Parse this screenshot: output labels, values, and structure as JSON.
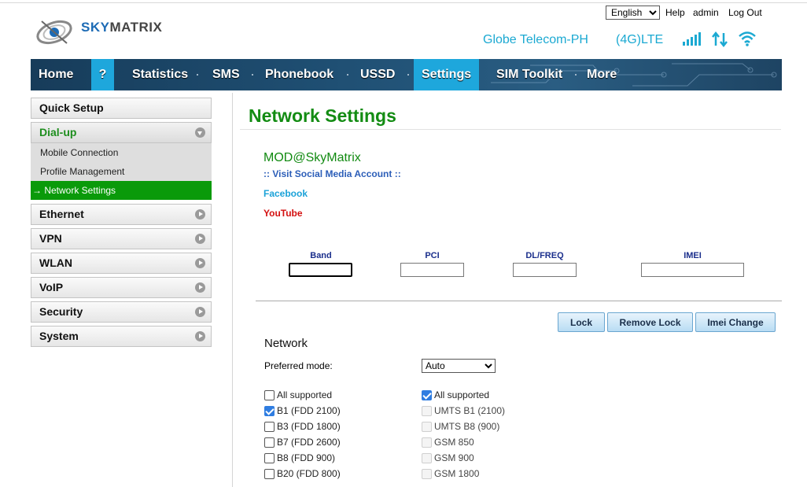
{
  "header": {
    "logo_text_a": "SKY",
    "logo_text_b": "MATRIX",
    "language": "English",
    "links": [
      "Help",
      "admin",
      "Log Out"
    ],
    "operator": "Globe Telecom-PH",
    "network_type": "(4G)LTE"
  },
  "nav": {
    "items": [
      "Home",
      "?",
      "Statistics",
      "SMS",
      "Phonebook",
      "USSD",
      "Settings",
      "SIM Toolkit",
      "More"
    ],
    "active": "Settings"
  },
  "sidebar": {
    "quick_setup": "Quick Setup",
    "dialup": "Dial-up",
    "sub_items": [
      "Mobile Connection",
      "Profile Management",
      "→ Network Settings"
    ],
    "groups": [
      "Ethernet",
      "VPN",
      "WLAN",
      "VoIP",
      "Security",
      "System"
    ]
  },
  "main": {
    "title": "Network Settings",
    "mod": "MOD@SkyMatrix",
    "visit": ":: Visit Social Media Account ::",
    "facebook": "Facebook",
    "youtube": "YouTube",
    "fields": [
      "Band",
      "PCI",
      "DL/FREQ",
      "IMEI"
    ],
    "buttons": [
      "Lock",
      "Remove Lock",
      "Imei Change"
    ],
    "section": "Network",
    "preferred_label": "Preferred mode:",
    "preferred_value": "Auto",
    "lte_bands": [
      {
        "label": "All supported",
        "checked": false
      },
      {
        "label": "B1 (FDD 2100)",
        "checked": true
      },
      {
        "label": "B3 (FDD 1800)",
        "checked": false
      },
      {
        "label": "B7 (FDD 2600)",
        "checked": false
      },
      {
        "label": "B8 (FDD 900)",
        "checked": false
      },
      {
        "label": "B20 (FDD 800)",
        "checked": false
      }
    ],
    "other_bands": [
      {
        "label": "All supported",
        "checked": true
      },
      {
        "label": "UMTS B1 (2100)",
        "checked": false
      },
      {
        "label": "UMTS B8 (900)",
        "checked": false
      },
      {
        "label": "GSM 850",
        "checked": false
      },
      {
        "label": "GSM 900",
        "checked": false
      },
      {
        "label": "GSM 1800",
        "checked": false
      }
    ]
  },
  "colors": {
    "accent_green": "#138c13",
    "nav_active": "#1ea7dc",
    "status_blue": "#1ba9d2"
  }
}
